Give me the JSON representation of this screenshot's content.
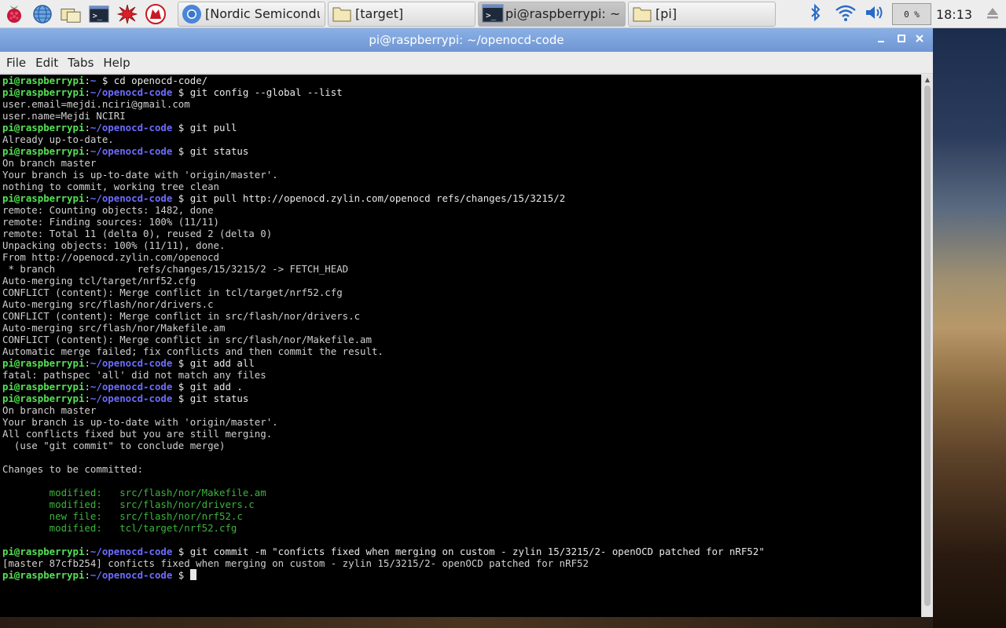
{
  "taskbar": {
    "tasks": [
      {
        "label": "[Nordic Semiconduc…",
        "icon": "chromium-icon"
      },
      {
        "label": "[target]",
        "icon": "folder-icon"
      },
      {
        "label": "pi@raspberrypi: ~/o…",
        "icon": "terminal-icon"
      },
      {
        "label": "[pi]",
        "icon": "folder-icon"
      }
    ],
    "cpu": "0 %",
    "clock": "18:13"
  },
  "window": {
    "title": "pi@raspberrypi: ~/openocd-code",
    "menu": [
      "File",
      "Edit",
      "Tabs",
      "Help"
    ]
  },
  "terminal": {
    "user": "pi@raspberrypi",
    "lines": [
      {
        "t": "p",
        "path": "~",
        "cmd": "cd openocd-code/"
      },
      {
        "t": "p",
        "path": "~/openocd-code",
        "cmd": "git config --global --list"
      },
      {
        "t": "o",
        "text": "user.email=mejdi.nciri@gmail.com"
      },
      {
        "t": "o",
        "text": "user.name=Mejdi NCIRI"
      },
      {
        "t": "p",
        "path": "~/openocd-code",
        "cmd": "git pull"
      },
      {
        "t": "o",
        "text": "Already up-to-date."
      },
      {
        "t": "p",
        "path": "~/openocd-code",
        "cmd": "git status"
      },
      {
        "t": "o",
        "text": "On branch master"
      },
      {
        "t": "o",
        "text": "Your branch is up-to-date with 'origin/master'."
      },
      {
        "t": "o",
        "text": "nothing to commit, working tree clean"
      },
      {
        "t": "p",
        "path": "~/openocd-code",
        "cmd": "git pull http://openocd.zylin.com/openocd refs/changes/15/3215/2"
      },
      {
        "t": "o",
        "text": "remote: Counting objects: 1482, done"
      },
      {
        "t": "o",
        "text": "remote: Finding sources: 100% (11/11)"
      },
      {
        "t": "o",
        "text": "remote: Total 11 (delta 0), reused 2 (delta 0)"
      },
      {
        "t": "o",
        "text": "Unpacking objects: 100% (11/11), done."
      },
      {
        "t": "o",
        "text": "From http://openocd.zylin.com/openocd"
      },
      {
        "t": "o",
        "text": " * branch              refs/changes/15/3215/2 -> FETCH_HEAD"
      },
      {
        "t": "o",
        "text": "Auto-merging tcl/target/nrf52.cfg"
      },
      {
        "t": "o",
        "text": "CONFLICT (content): Merge conflict in tcl/target/nrf52.cfg"
      },
      {
        "t": "o",
        "text": "Auto-merging src/flash/nor/drivers.c"
      },
      {
        "t": "o",
        "text": "CONFLICT (content): Merge conflict in src/flash/nor/drivers.c"
      },
      {
        "t": "o",
        "text": "Auto-merging src/flash/nor/Makefile.am"
      },
      {
        "t": "o",
        "text": "CONFLICT (content): Merge conflict in src/flash/nor/Makefile.am"
      },
      {
        "t": "o",
        "text": "Automatic merge failed; fix conflicts and then commit the result."
      },
      {
        "t": "p",
        "path": "~/openocd-code",
        "cmd": "git add all"
      },
      {
        "t": "o",
        "text": "fatal: pathspec 'all' did not match any files"
      },
      {
        "t": "p",
        "path": "~/openocd-code",
        "cmd": "git add ."
      },
      {
        "t": "p",
        "path": "~/openocd-code",
        "cmd": "git status"
      },
      {
        "t": "o",
        "text": "On branch master"
      },
      {
        "t": "o",
        "text": "Your branch is up-to-date with 'origin/master'."
      },
      {
        "t": "o",
        "text": "All conflicts fixed but you are still merging."
      },
      {
        "t": "o",
        "text": "  (use \"git commit\" to conclude merge)"
      },
      {
        "t": "o",
        "text": ""
      },
      {
        "t": "o",
        "text": "Changes to be committed:"
      },
      {
        "t": "o",
        "text": ""
      },
      {
        "t": "g",
        "text": "        modified:   src/flash/nor/Makefile.am"
      },
      {
        "t": "g",
        "text": "        modified:   src/flash/nor/drivers.c"
      },
      {
        "t": "g",
        "text": "        new file:   src/flash/nor/nrf52.c"
      },
      {
        "t": "g",
        "text": "        modified:   tcl/target/nrf52.cfg"
      },
      {
        "t": "o",
        "text": ""
      },
      {
        "t": "p",
        "path": "~/openocd-code",
        "cmd": "git commit -m \"conficts fixed when merging on custom - zylin 15/3215/2- openOCD patched for nRF52\""
      },
      {
        "t": "o",
        "text": "[master 87cfb254] conficts fixed when merging on custom - zylin 15/3215/2- openOCD patched for nRF52"
      },
      {
        "t": "c",
        "path": "~/openocd-code",
        "cmd": ""
      }
    ]
  }
}
